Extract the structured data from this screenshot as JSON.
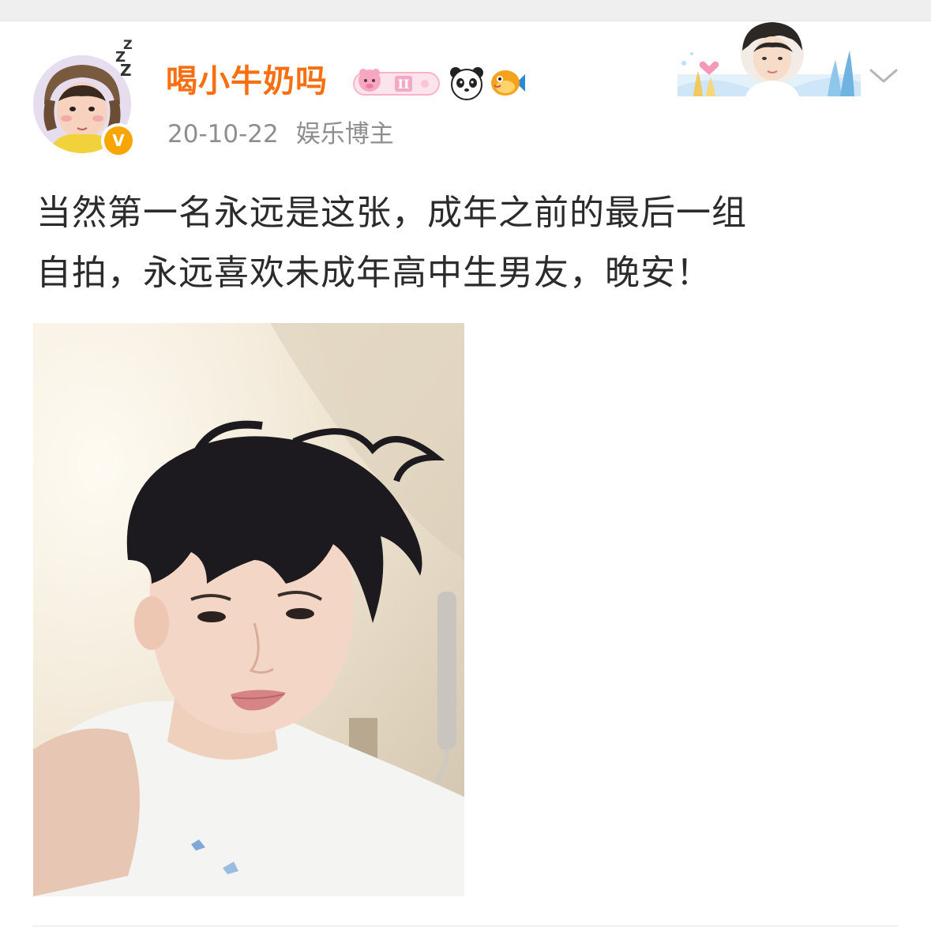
{
  "post": {
    "author": {
      "name": "喝小牛奶吗",
      "name_color": "#f86f12",
      "verified": true,
      "verified_badge_icon": "v-badge-icon",
      "badges": [
        "level-badge-icon",
        "panda-icon",
        "fish-icon"
      ]
    },
    "time": "20-10-22",
    "tag": "娱乐博主",
    "text_lines": [
      "当然第一名永远是这张，成年之前的最后一组",
      "自拍，永远喜欢未成年高中生男友，晚安！"
    ],
    "image_icon": "selfie-photo",
    "more_menu_icon": "chevron-down-icon"
  },
  "colors": {
    "accent": "#f86f12",
    "meta_text": "#8e8e8e",
    "body_text": "#2b2b2b",
    "verified": "#f9a602"
  }
}
